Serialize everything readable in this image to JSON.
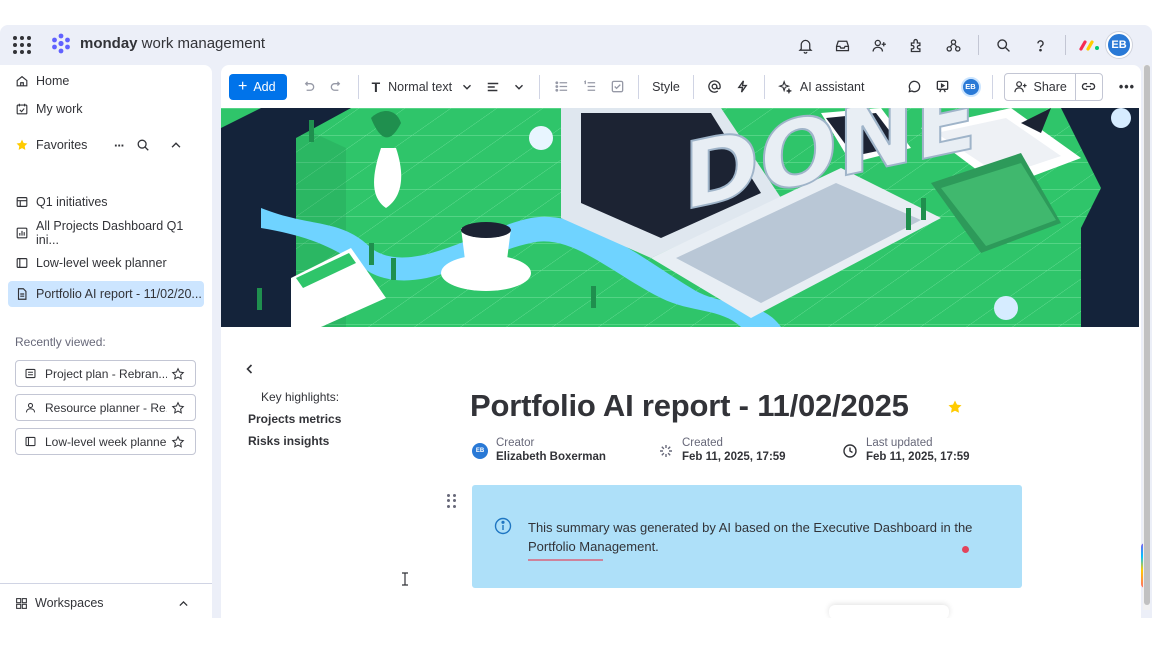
{
  "topbar": {
    "brand_bold": "monday",
    "brand_rest": " work management",
    "avatar_initials": "EB",
    "icons": [
      "bell-icon",
      "inbox-icon",
      "invite-icon",
      "apps-icon",
      "integrations-icon",
      "search-icon",
      "help-icon"
    ]
  },
  "sidebar": {
    "home": "Home",
    "my_work": "My work",
    "favorites": "Favorites",
    "favorites_more": "···",
    "items": [
      {
        "label": "Q1 initiatives",
        "icon": "board-icon"
      },
      {
        "label": "All Projects Dashboard Q1 ini...",
        "icon": "dashboard-icon"
      },
      {
        "label": "Low-level week planner",
        "icon": "panel-icon"
      },
      {
        "label": "Portfolio AI report - 11/02/20...",
        "icon": "doc-icon",
        "active": true
      }
    ],
    "recently_viewed_label": "Recently viewed:",
    "recent": [
      {
        "label": "Project plan - Rebran..."
      },
      {
        "label": "Resource planner - Re..."
      },
      {
        "label": "Low-level week planner"
      }
    ],
    "workspaces": "Workspaces"
  },
  "toolbar": {
    "add_label": "Add",
    "text_style": "Normal text",
    "style_label": "Style",
    "ai_label": "AI assistant",
    "share_label": "Share",
    "small_avatar": "EB",
    "more": "•••"
  },
  "doc": {
    "title": "Portfolio AI report - 11/02/2025",
    "highlights_title": "Key highlights:",
    "highlights": [
      "Projects metrics",
      "Risks insights"
    ],
    "meta": {
      "creator_label": "Creator",
      "creator_value": "Elizabeth Boxerman",
      "creator_initials": "EB",
      "created_label": "Created",
      "created_value": "Feb 11, 2025, 17:59",
      "updated_label": "Last updated",
      "updated_value": "Feb 11, 2025, 17:59"
    },
    "callout_text": "This summary was generated by AI based on the Executive Dashboard in the Portfolio Management.",
    "cover_word": "DONE"
  },
  "colors": {
    "primary": "#0073ea",
    "app_bg": "#eceff8",
    "active_item": "#cce5ff",
    "callout_bg": "#aee0f9",
    "cover_green": "#2fc56a",
    "star": "#ffcb00"
  }
}
